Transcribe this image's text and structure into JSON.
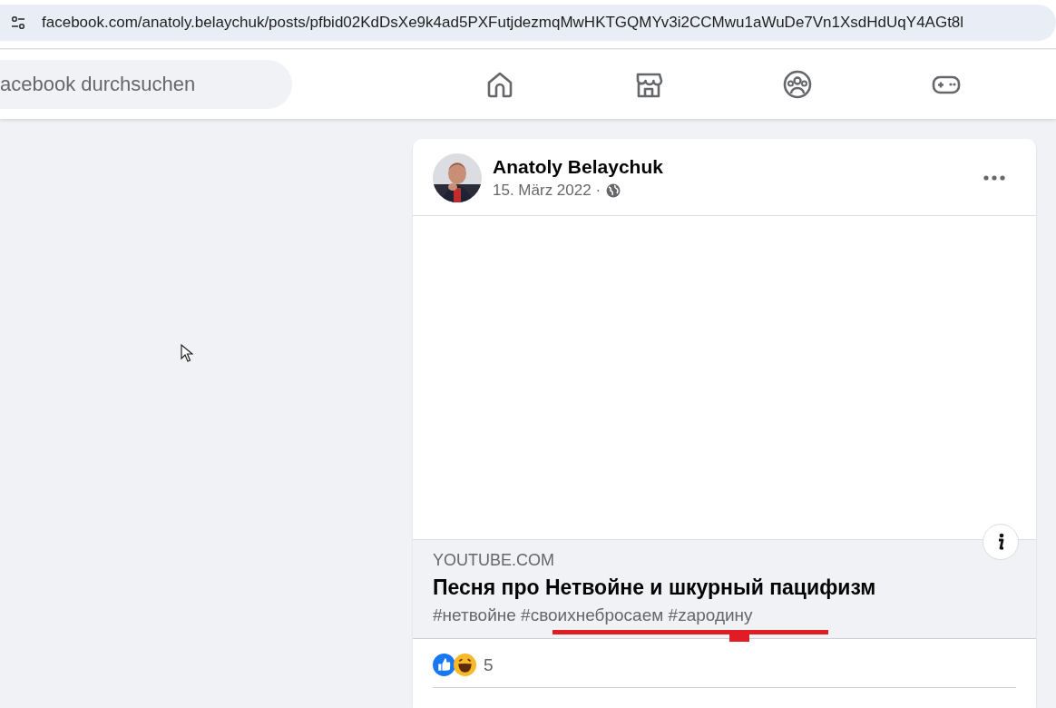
{
  "address_bar": {
    "url": "facebook.com/anatoly.belaychuk/posts/pfbid02KdDsXe9k4ad5PXFutjdezmqMwHKTGQMYv3i2CCMwu1aWuDe7Vn1XsdHdUqY4AGt8l"
  },
  "search": {
    "placeholder": "acebook durchsuchen"
  },
  "post": {
    "author": "Anatoly Belaychuk",
    "date": "15. März 2022 ·",
    "link_preview": {
      "domain": "YOUTUBE.COM",
      "title": "Песня про Нетвойне и шкурный пацифизм",
      "hashtags": "#нетвойне #своихнебросаем #zародину"
    },
    "reactions": {
      "count": "5"
    }
  }
}
